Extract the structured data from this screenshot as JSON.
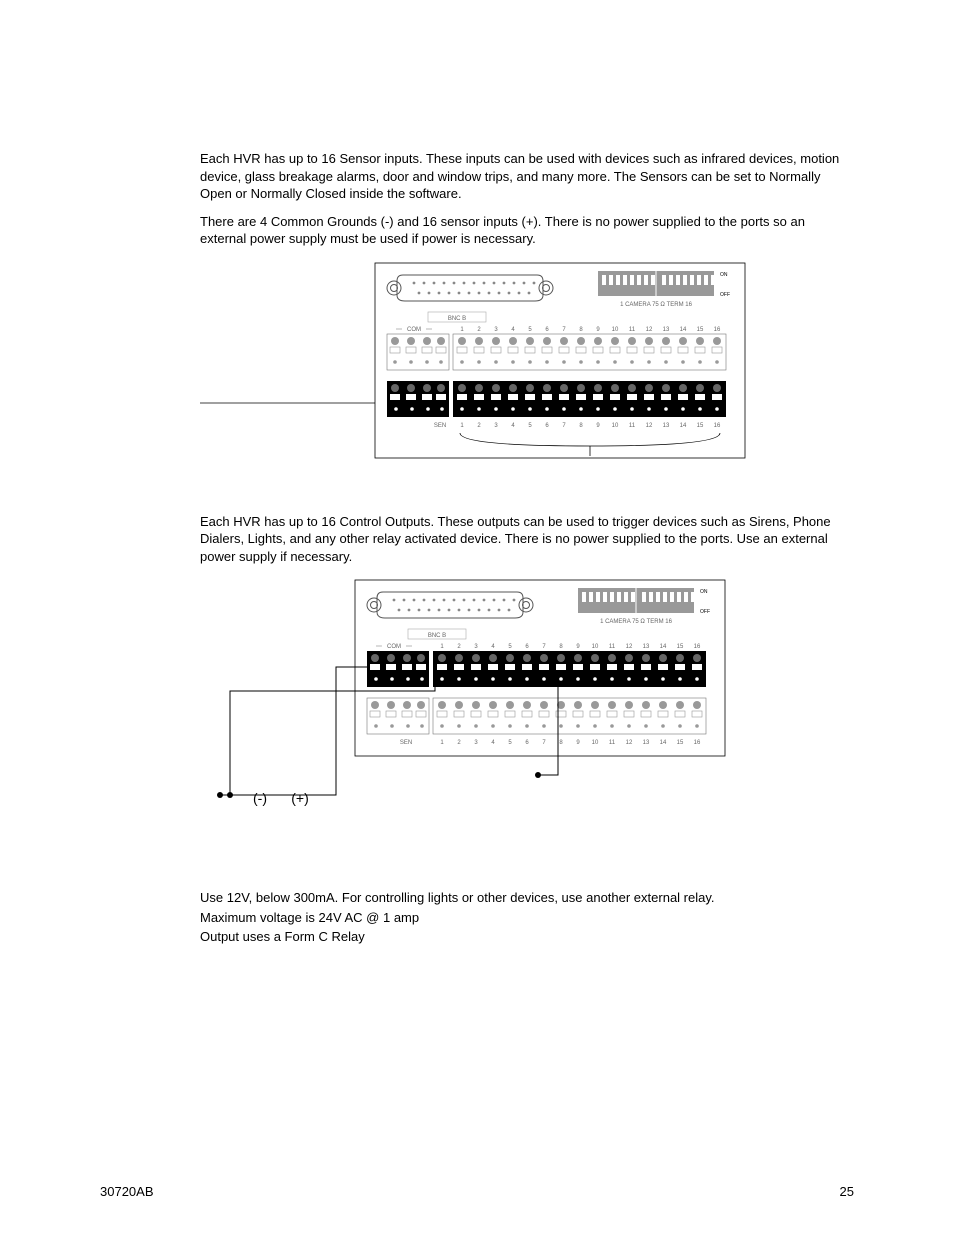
{
  "paragraphs": {
    "p1": "Each HVR has up to 16 Sensor inputs. These inputs can be used with devices such as infrared devices, motion device, glass breakage alarms, door and window trips, and many more. The Sensors can be set to Normally Open or Normally Closed inside the software.",
    "p2": "There are 4 Common Grounds (-) and 16 sensor inputs (+). There is no power supplied to the ports so an external power supply must be used if power is necessary.",
    "p3": "Each HVR has up to 16 Control Outputs. These outputs can be used to trigger devices such as Sirens, Phone Dialers, Lights, and any other relay activated device.  There is no power supplied to the ports. Use an external power supply if necessary."
  },
  "diagram_labels": {
    "on": "ON",
    "off": "OFF",
    "camera_term": "1 CAMERA 75 Ω   TERM 16",
    "bnc_b": "BNC B",
    "com": "COM",
    "sen": "SEN",
    "minus": "(-)",
    "plus": "(+)"
  },
  "port_numbers": [
    "1",
    "2",
    "3",
    "4",
    "5",
    "6",
    "7",
    "8",
    "9",
    "10",
    "11",
    "12",
    "13",
    "14",
    "15",
    "16"
  ],
  "notes": {
    "n1": "Use 12V, below 300mA. For controlling lights or other devices, use another external relay.",
    "n2": "Maximum voltage is 24V AC @ 1 amp",
    "n3": "Output uses a Form C Relay"
  },
  "footer": {
    "doc_id": "30720AB",
    "page_num": "25"
  }
}
